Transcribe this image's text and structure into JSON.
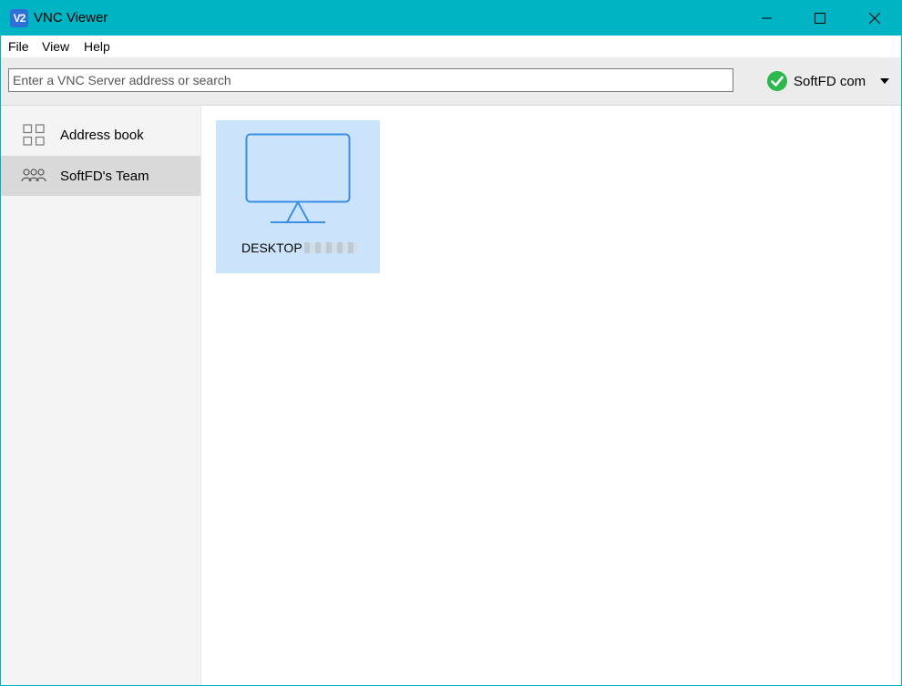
{
  "window": {
    "app_icon_text": "V2",
    "title": "VNC Viewer"
  },
  "menu": {
    "items": [
      {
        "label": "File"
      },
      {
        "label": "View"
      },
      {
        "label": "Help"
      }
    ]
  },
  "toolbar": {
    "search_placeholder": "Enter a VNC Server address or search",
    "search_value": "",
    "account_name": "SoftFD com",
    "account_status_icon": "check-circle-icon",
    "account_status_color": "#2db84d"
  },
  "sidebar": {
    "items": [
      {
        "label": "Address book",
        "icon": "grid-icon",
        "selected": false
      },
      {
        "label": "SoftFD's Team",
        "icon": "team-icon",
        "selected": true
      }
    ]
  },
  "main": {
    "computers": [
      {
        "label": "DESKTOP",
        "icon": "monitor-icon",
        "selected": true
      }
    ]
  },
  "colors": {
    "titlebar": "#00b4c4",
    "tile_selected": "#cce4fb",
    "monitor_stroke": "#3a8fe3"
  }
}
